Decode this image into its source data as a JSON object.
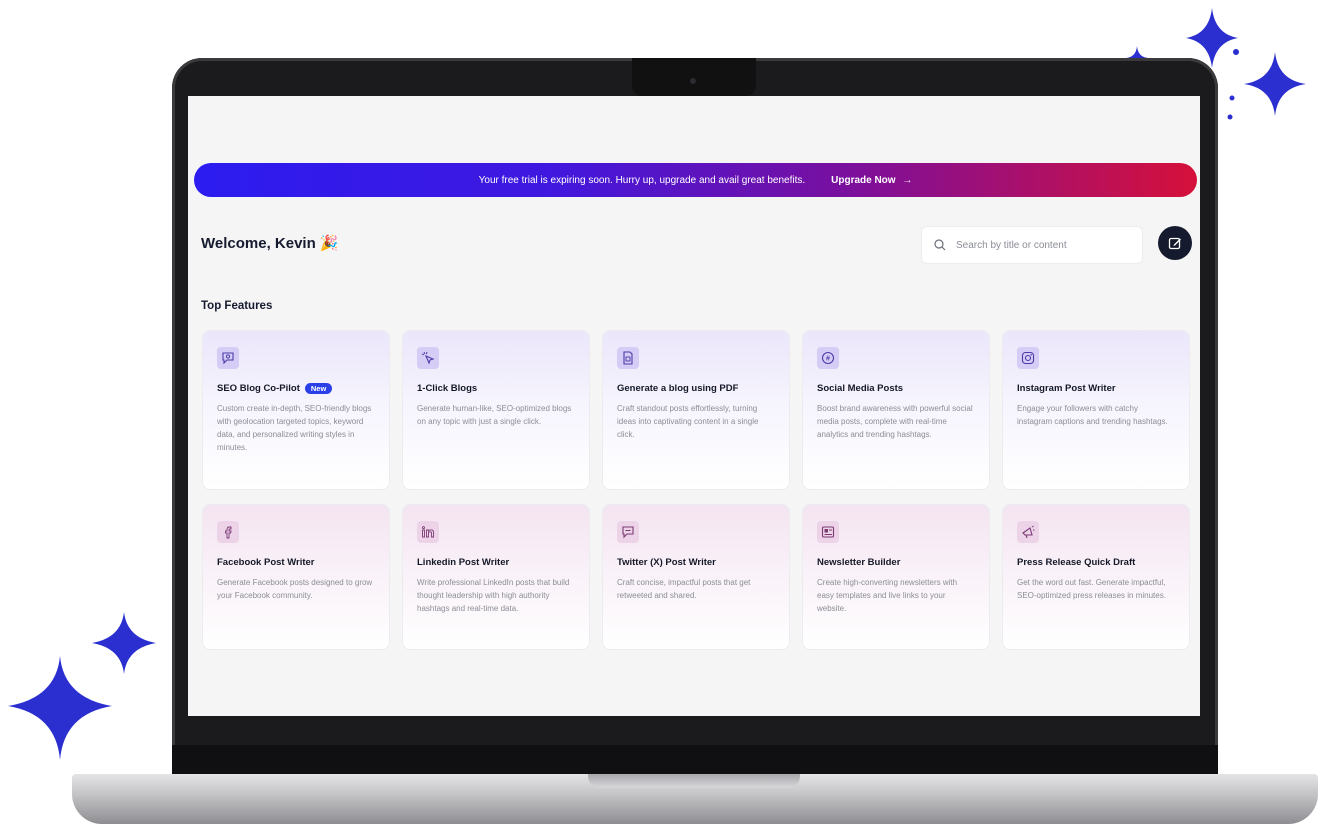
{
  "banner": {
    "message": "Your free trial is expiring soon. Hurry up, upgrade and avail great benefits.",
    "cta_label": "Upgrade Now",
    "cta_arrow": "→"
  },
  "header": {
    "welcome_text": "Welcome,  Kevin 🎉",
    "search_placeholder": "Search by title or content"
  },
  "section": {
    "title": "Top Features"
  },
  "features": [
    {
      "title": "SEO Blog Co-Pilot",
      "badge": "New",
      "icon": "search-chat-icon",
      "description": "Custom create in-depth, SEO-friendly blogs with geolocation targeted topics, keyword data, and personalized writing styles in minutes."
    },
    {
      "title": "1-Click Blogs",
      "icon": "cursor-click-icon",
      "description": "Generate human-like, SEO-optimized blogs on any topic with just a single click."
    },
    {
      "title": "Generate a blog using PDF",
      "icon": "pdf-file-icon",
      "description": "Craft standout posts effortlessly, turning ideas into captivating content in a single click."
    },
    {
      "title": "Social Media Posts",
      "icon": "hashtag-icon",
      "description": "Boost brand awareness with powerful social media posts, complete with real-time analytics and trending hashtags."
    },
    {
      "title": "Instagram Post Writer",
      "icon": "instagram-icon",
      "description": "Engage your followers with catchy instagram captions and trending hashtags."
    },
    {
      "title": "Facebook Post Writer",
      "icon": "facebook-icon",
      "description": "Generate Facebook posts designed to grow your Facebook community."
    },
    {
      "title": "Linkedin Post Writer",
      "icon": "linkedin-icon",
      "description": "Write professional LinkedIn posts that build thought leadership with high authority hashtags and real-time data."
    },
    {
      "title": "Twitter (X) Post Writer",
      "icon": "chat-bubble-icon",
      "description": "Craft concise, impactful posts that get retweeted and shared."
    },
    {
      "title": "Newsletter Builder",
      "icon": "newsletter-icon",
      "description": "Create high-converting newsletters with easy templates and live links to your website."
    },
    {
      "title": "Press Release Quick Draft",
      "icon": "megaphone-icon",
      "description": "Get the word out fast. Generate impactful, SEO-optimized press releases in minutes."
    }
  ],
  "colors": {
    "accent": "#2b3fe8",
    "dark": "#161a2e",
    "sparkle": "#2b2fd0",
    "banner_start": "#2c1cf0",
    "banner_end": "#d6103a"
  }
}
